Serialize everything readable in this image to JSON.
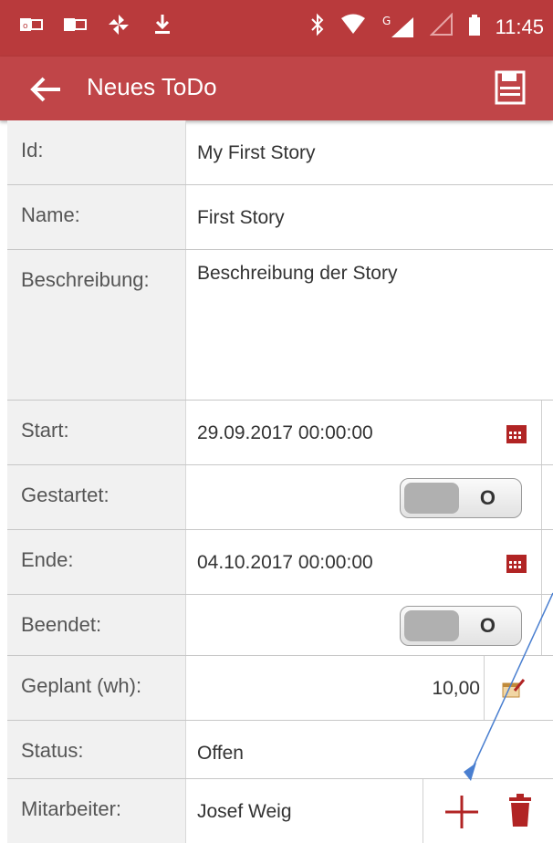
{
  "status_bar": {
    "time": "11:45"
  },
  "app_bar": {
    "title": "Neues ToDo"
  },
  "form": {
    "id": {
      "label": "Id:",
      "value": "My First Story"
    },
    "name": {
      "label": "Name:",
      "value": "First Story"
    },
    "description": {
      "label": "Beschreibung:",
      "value": "Beschreibung der Story"
    },
    "start": {
      "label": "Start:",
      "value": "29.09.2017 00:00:00"
    },
    "started": {
      "label": "Gestartet:",
      "toggle_text": "O"
    },
    "end": {
      "label": "Ende:",
      "value": "04.10.2017 00:00:00"
    },
    "finished": {
      "label": "Beendet:",
      "toggle_text": "O"
    },
    "planned": {
      "label": "Geplant (wh):",
      "value": "10,00"
    },
    "status": {
      "label": "Status:",
      "value": "Offen"
    },
    "employee": {
      "label": "Mitarbeiter:",
      "value": "Josef Weig"
    }
  },
  "colors": {
    "accent": "#c04548",
    "statusbar": "#b93a3c",
    "icon_red": "#b12424",
    "arrow": "#4a7fd0"
  }
}
